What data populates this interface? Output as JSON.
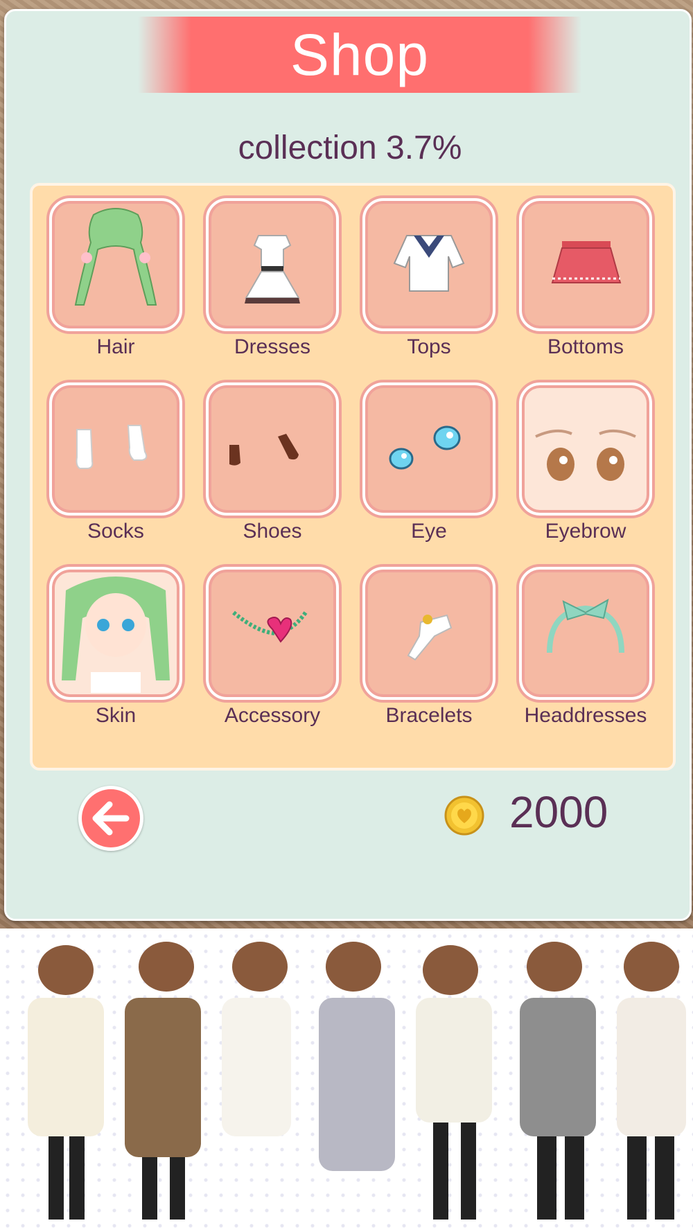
{
  "title": "Shop",
  "collection_text": "collection 3.7%",
  "categories": [
    {
      "label": "Hair",
      "icon": "hair-icon"
    },
    {
      "label": "Dresses",
      "icon": "dress-icon"
    },
    {
      "label": "Tops",
      "icon": "top-icon"
    },
    {
      "label": "Bottoms",
      "icon": "skirt-icon"
    },
    {
      "label": "Socks",
      "icon": "socks-icon"
    },
    {
      "label": "Shoes",
      "icon": "shoes-icon"
    },
    {
      "label": "Eye",
      "icon": "eye-icon"
    },
    {
      "label": "Eyebrow",
      "icon": "eyebrow-icon"
    },
    {
      "label": "Skin",
      "icon": "skin-icon"
    },
    {
      "label": "Accessory",
      "icon": "necklace-icon"
    },
    {
      "label": "Bracelets",
      "icon": "bracelet-icon"
    },
    {
      "label": "Headdresses",
      "icon": "headband-icon"
    }
  ],
  "coins": "2000",
  "colors": {
    "panel": "#dcede6",
    "banner": "#ff6f6f",
    "board": "#ffdcaa",
    "tile": "#f5b9a3",
    "text": "#5a2f55"
  }
}
